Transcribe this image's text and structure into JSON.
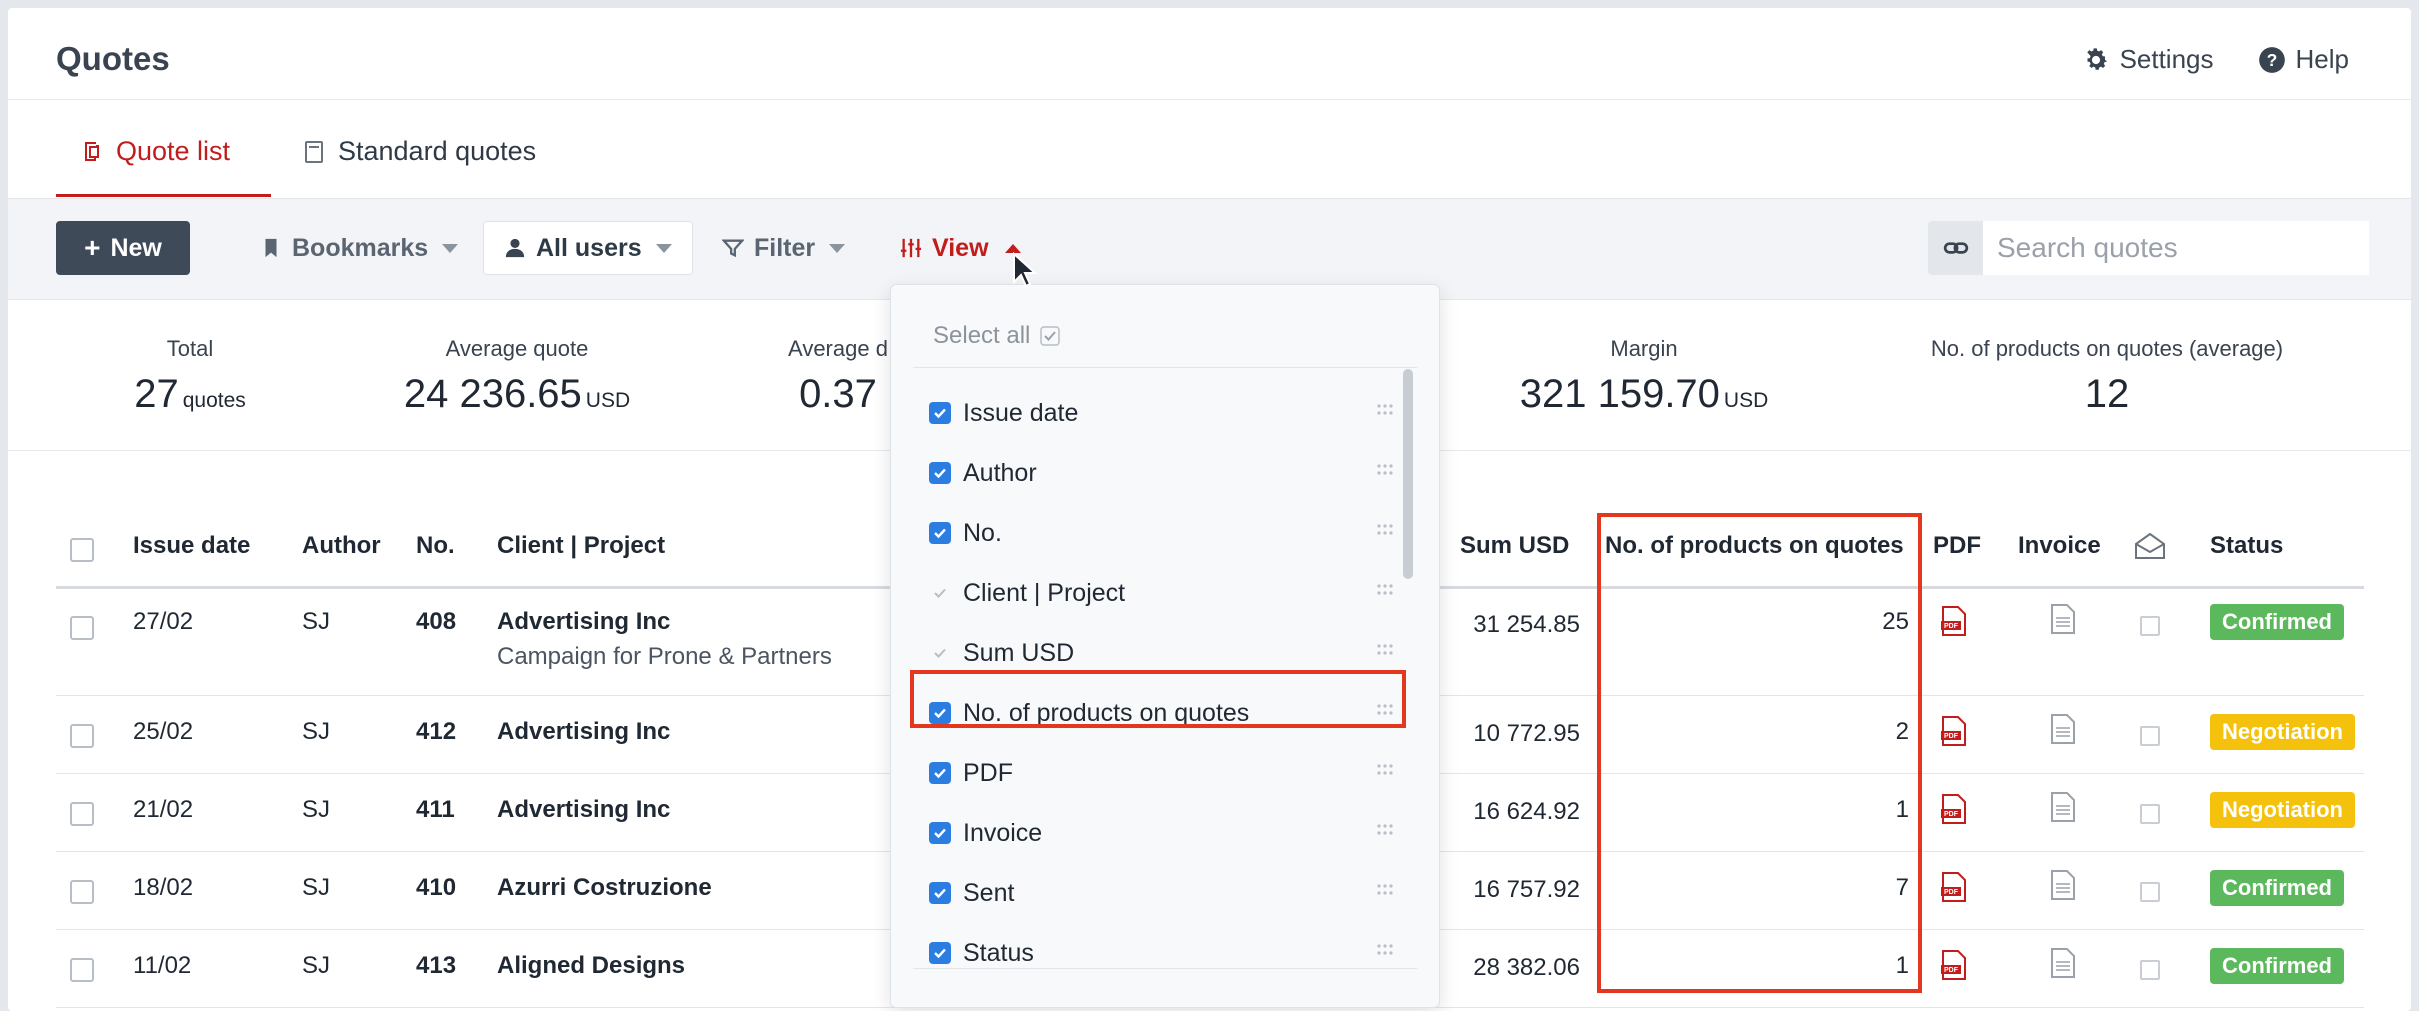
{
  "app": {
    "title": "Quotes"
  },
  "top_actions": {
    "settings": "Settings",
    "help": "Help"
  },
  "tabs": [
    {
      "label": "Quote list",
      "active": true
    },
    {
      "label": "Standard quotes",
      "active": false
    }
  ],
  "toolbar": {
    "new_label": "New",
    "bookmarks_label": "Bookmarks",
    "users_label": "All users",
    "filter_label": "Filter",
    "view_label": "View",
    "search_placeholder": "Search quotes"
  },
  "stats": {
    "total": {
      "label": "Total",
      "value": "27",
      "unit": "quotes"
    },
    "average_quote": {
      "label": "Average quote",
      "value": "24 236.65",
      "unit": "USD"
    },
    "average_d": {
      "label": "Average d",
      "value": "0.37"
    },
    "margin": {
      "label": "Margin",
      "value": "321 159.70",
      "unit": "USD"
    },
    "products_avg": {
      "label": "No. of products on quotes (average)",
      "value": "12"
    }
  },
  "table": {
    "headers": {
      "issue_date": "Issue date",
      "author": "Author",
      "no": "No.",
      "client_project": "Client | Project",
      "sum_usd": "Sum USD",
      "products": "No. of products on quotes",
      "pdf": "PDF",
      "invoice": "Invoice",
      "status": "Status"
    },
    "rows": [
      {
        "date": "27/02",
        "author": "SJ",
        "no": "408",
        "client": "Advertising Inc",
        "project": "Campaign for Prone & Partners",
        "sum": "31 254.85",
        "products": "25",
        "status": "Confirmed"
      },
      {
        "date": "25/02",
        "author": "SJ",
        "no": "412",
        "client": "Advertising Inc",
        "project": "",
        "sum": "10 772.95",
        "products": "2",
        "status": "Negotiation"
      },
      {
        "date": "21/02",
        "author": "SJ",
        "no": "411",
        "client": "Advertising Inc",
        "project": "",
        "sum": "16 624.92",
        "products": "1",
        "status": "Negotiation"
      },
      {
        "date": "18/02",
        "author": "SJ",
        "no": "410",
        "client": "Azurri Costruzione",
        "project": "",
        "sum": "16 757.92",
        "products": "7",
        "status": "Confirmed"
      },
      {
        "date": "11/02",
        "author": "SJ",
        "no": "413",
        "client": "Aligned Designs",
        "project": "",
        "sum": "28 382.06",
        "products": "1",
        "status": "Confirmed"
      }
    ]
  },
  "view_menu": {
    "select_all": "Select all",
    "items": [
      {
        "label": "Issue date",
        "checked": true,
        "locked": false
      },
      {
        "label": "Author",
        "checked": true,
        "locked": false
      },
      {
        "label": "No.",
        "checked": true,
        "locked": false
      },
      {
        "label": "Client | Project",
        "checked": true,
        "locked": true
      },
      {
        "label": "Sum USD",
        "checked": true,
        "locked": true
      },
      {
        "label": "No. of products on quotes",
        "checked": true,
        "locked": false
      },
      {
        "label": "PDF",
        "checked": true,
        "locked": false
      },
      {
        "label": "Invoice",
        "checked": true,
        "locked": false
      },
      {
        "label": "Sent",
        "checked": true,
        "locked": false
      },
      {
        "label": "Status",
        "checked": true,
        "locked": false
      }
    ]
  },
  "colors": {
    "accent_red": "#c21d1d",
    "highlight": "#e3371e",
    "confirmed": "#5cb85c",
    "negotiation": "#f4c20d",
    "checkbox_blue": "#2b7de1"
  }
}
